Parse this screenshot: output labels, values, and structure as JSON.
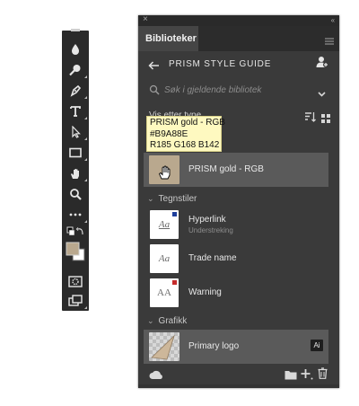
{
  "toolbar": {
    "tools": [
      "collapse-handle",
      "eyedropper-icon",
      "spot-heal-icon",
      "pen-icon",
      "type-icon",
      "selection-icon",
      "rectangle-icon",
      "hand-icon",
      "zoom-icon",
      "more-icon",
      "default-colors-icon",
      "swatches-icon",
      "quick-mask-icon",
      "screen-mode-icon"
    ],
    "foreground_color": "#b9a88e",
    "background_color": "#ffffff"
  },
  "panel": {
    "close_glyph": "×",
    "collapse_glyph": "‹‹",
    "tab_label": "Biblioteker",
    "library_title": "PRISM STYLE GUIDE",
    "search_placeholder": "Søk i gjeldende bibliotek",
    "view_label": "Vis etter type"
  },
  "tooltip": {
    "name": "PRISM gold - RGB",
    "hex": "#B9A88E",
    "rgb": "R185 G168 B142"
  },
  "colors": {
    "swatch_name": "PRISM gold - RGB",
    "swatch_color": "#b9a88e"
  },
  "sections": {
    "character_styles": "Tegnstiler",
    "graphics": "Grafikk"
  },
  "character_styles": [
    {
      "name": "Hyperlink",
      "sub": "Understreking",
      "preview": "Aa",
      "flag_color": "#1f3f9c"
    },
    {
      "name": "Trade name",
      "sub": "",
      "preview": "Aa",
      "flag_color": ""
    },
    {
      "name": "Warning",
      "sub": "",
      "preview": "AA",
      "flag_color": "#c62b2b"
    }
  ],
  "graphics": [
    {
      "name": "Primary logo",
      "badge": "Ai"
    }
  ]
}
